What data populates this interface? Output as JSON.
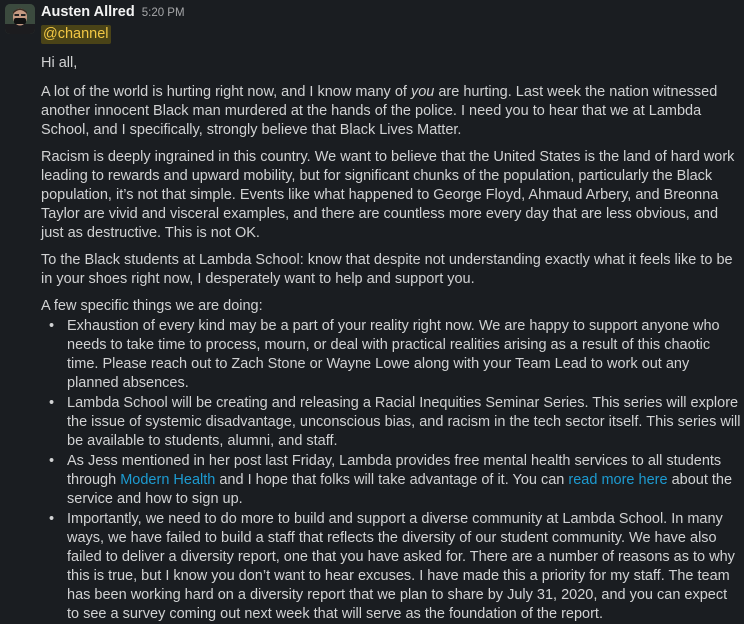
{
  "message": {
    "author": "Austen Allred",
    "time": "5:20 PM",
    "mention": "@channel",
    "greeting": "Hi all,",
    "p1_a": "A lot of the world is hurting right now, and I know many of ",
    "p1_em": "you",
    "p1_b": " are hurting. Last week the nation witnessed another innocent Black man murdered at the hands of the police. I need you to hear that we at Lambda School, and I specifically, strongly believe that Black Lives Matter.",
    "p2": "Racism is deeply ingrained in this country. We want to believe that the United States is the land of hard work leading to rewards and upward mobility, but for significant chunks of the population, particularly the Black population, it’s not that simple. Events like what happened to George Floyd, Ahmaud Arbery, and Breonna Taylor are vivid and visceral examples, and there are countless more every day that are less obvious, and just as destructive. This is not OK.",
    "p3": "To the Black students at Lambda School: know that despite not understanding exactly what it feels like to be in your shoes right now, I desperately want to help and support you.",
    "list_intro": "A few specific things we are doing:",
    "bullets": {
      "b1": "Exhaustion of every kind may be a part of your reality right now. We are happy to support anyone who needs to take time to process, mourn, or deal with practical realities arising as a result of this chaotic time. Please reach out to Zach Stone or Wayne Lowe along with your Team Lead to work out any planned absences.",
      "b2": "Lambda School will be creating and releasing a Racial Inequities Seminar Series. This series will explore the issue of systemic disadvantage, unconscious bias, and racism in the tech sector itself. This series will be available to students, alumni, and staff.",
      "b3_a": "As Jess mentioned in her post last Friday, Lambda provides free mental health services to all students through ",
      "b3_link1": "Modern Health",
      "b3_b": " and I hope that folks will take advantage of it. You can ",
      "b3_link2": "read more here",
      "b3_c": " about the service and how to sign up.",
      "b4": "Importantly, we need to do more to build and support a diverse community at Lambda School. In many ways, we have failed to build a staff that reflects the diversity of our student community. We have also failed to deliver a diversity report, one that you have asked for. There are a number of reasons as to why this is true, but I know you don’t want to hear excuses. I have made this a priority for my staff. The team has been working hard on a diversity report that we plan to share by July 31, 2020, and you can expect to see a survey coming out next week that will serve as the foundation of the report."
    },
    "bullet_glyph": "•"
  },
  "colors": {
    "background": "#1a1d21",
    "text": "#d1d2d3",
    "link": "#1d9bd1",
    "mention_bg": "#4a4317",
    "mention_text": "#f2c744"
  }
}
